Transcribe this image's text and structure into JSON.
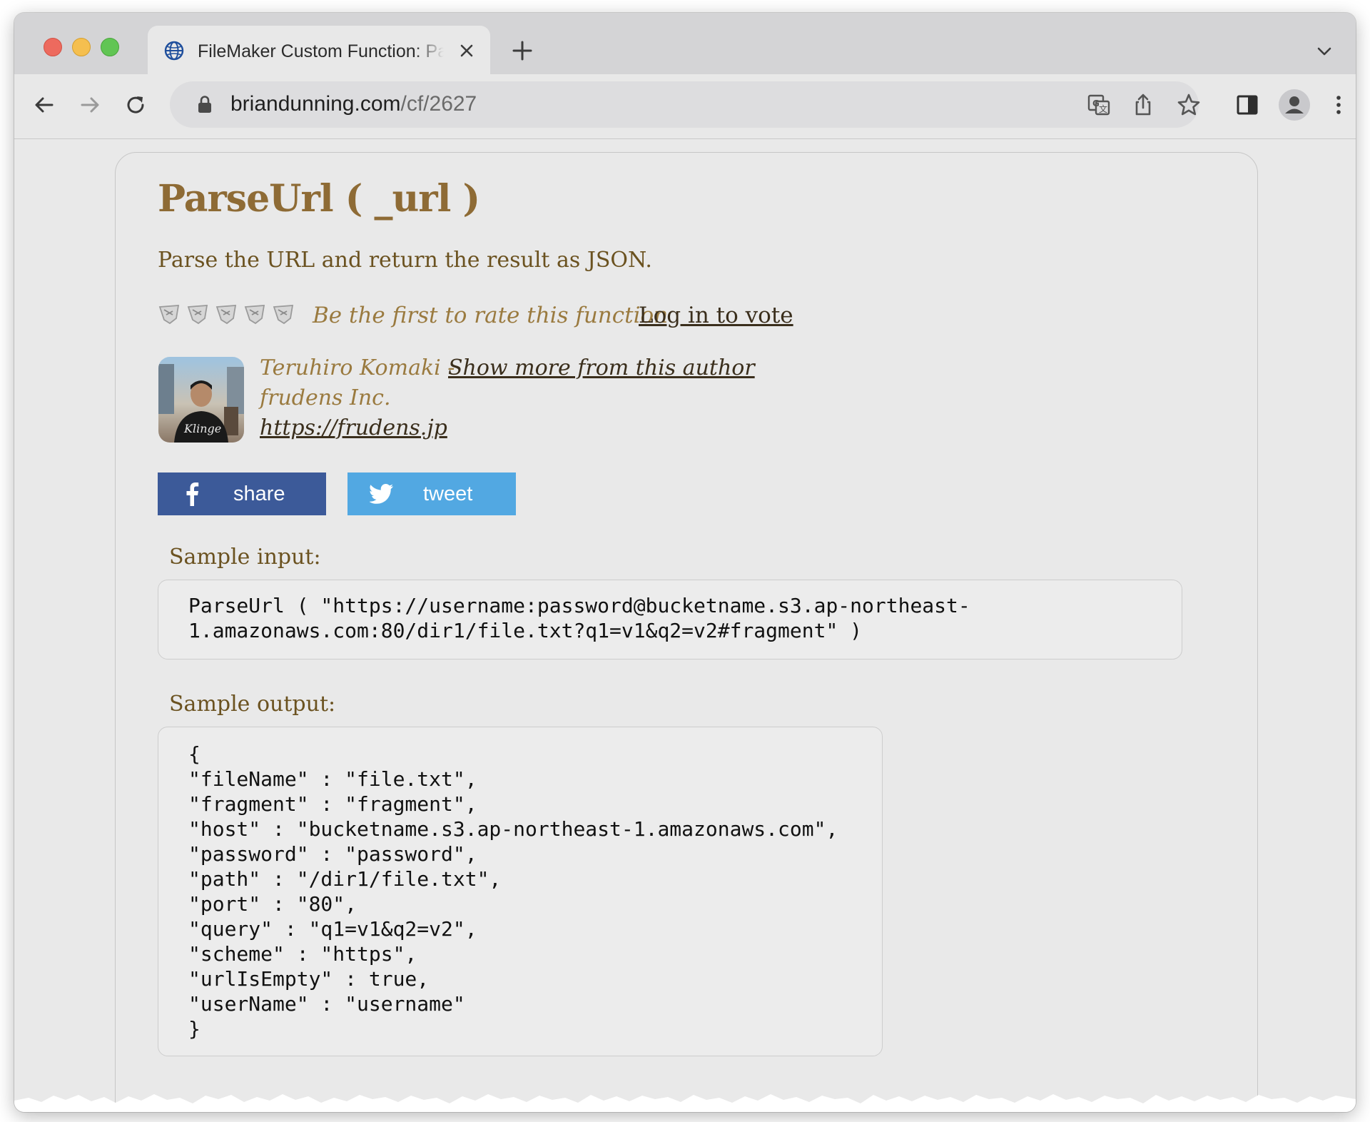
{
  "browser": {
    "tab": {
      "title": "FileMaker Custom Function: Pa",
      "favicon": "globe-icon"
    },
    "url": {
      "host": "briandunning.com",
      "path": "/cf/2627"
    }
  },
  "function": {
    "title": "ParseUrl ( _url )",
    "description": "Parse the URL and return the result as JSON.",
    "rating": {
      "stars_filled": 0,
      "stars_total": 5,
      "prompt": "Be the first to rate this function",
      "vote_link": "Log in to vote"
    }
  },
  "author": {
    "name": "Teruhiro Komaki - ",
    "more_link": "Show more from this author",
    "company": "frudens Inc.",
    "website": "https://frudens.jp"
  },
  "share": {
    "facebook_label": "share",
    "twitter_label": "tweet"
  },
  "sample_input": {
    "label": "Sample input:",
    "code": "ParseUrl ( \"https://username:password@bucketname.s3.ap-northeast-\n1.amazonaws.com:80/dir1/file.txt?q1=v1&q2=v2#fragment\" )"
  },
  "sample_output": {
    "label": "Sample output:",
    "code": "{\n\"fileName\" : \"file.txt\",\n\"fragment\" : \"fragment\",\n\"host\" : \"bucketname.s3.ap-northeast-1.amazonaws.com\",\n\"password\" : \"password\",\n\"path\" : \"/dir1/file.txt\",\n\"port\" : \"80\",\n\"query\" : \"q1=v1&q2=v2\",\n\"scheme\" : \"https\",\n\"urlIsEmpty\" : true,\n\"userName\" : \"username\"\n}"
  },
  "colors": {
    "title": "#8e6b35",
    "facebook": "#3c5a99",
    "twitter": "#52a8e2"
  }
}
